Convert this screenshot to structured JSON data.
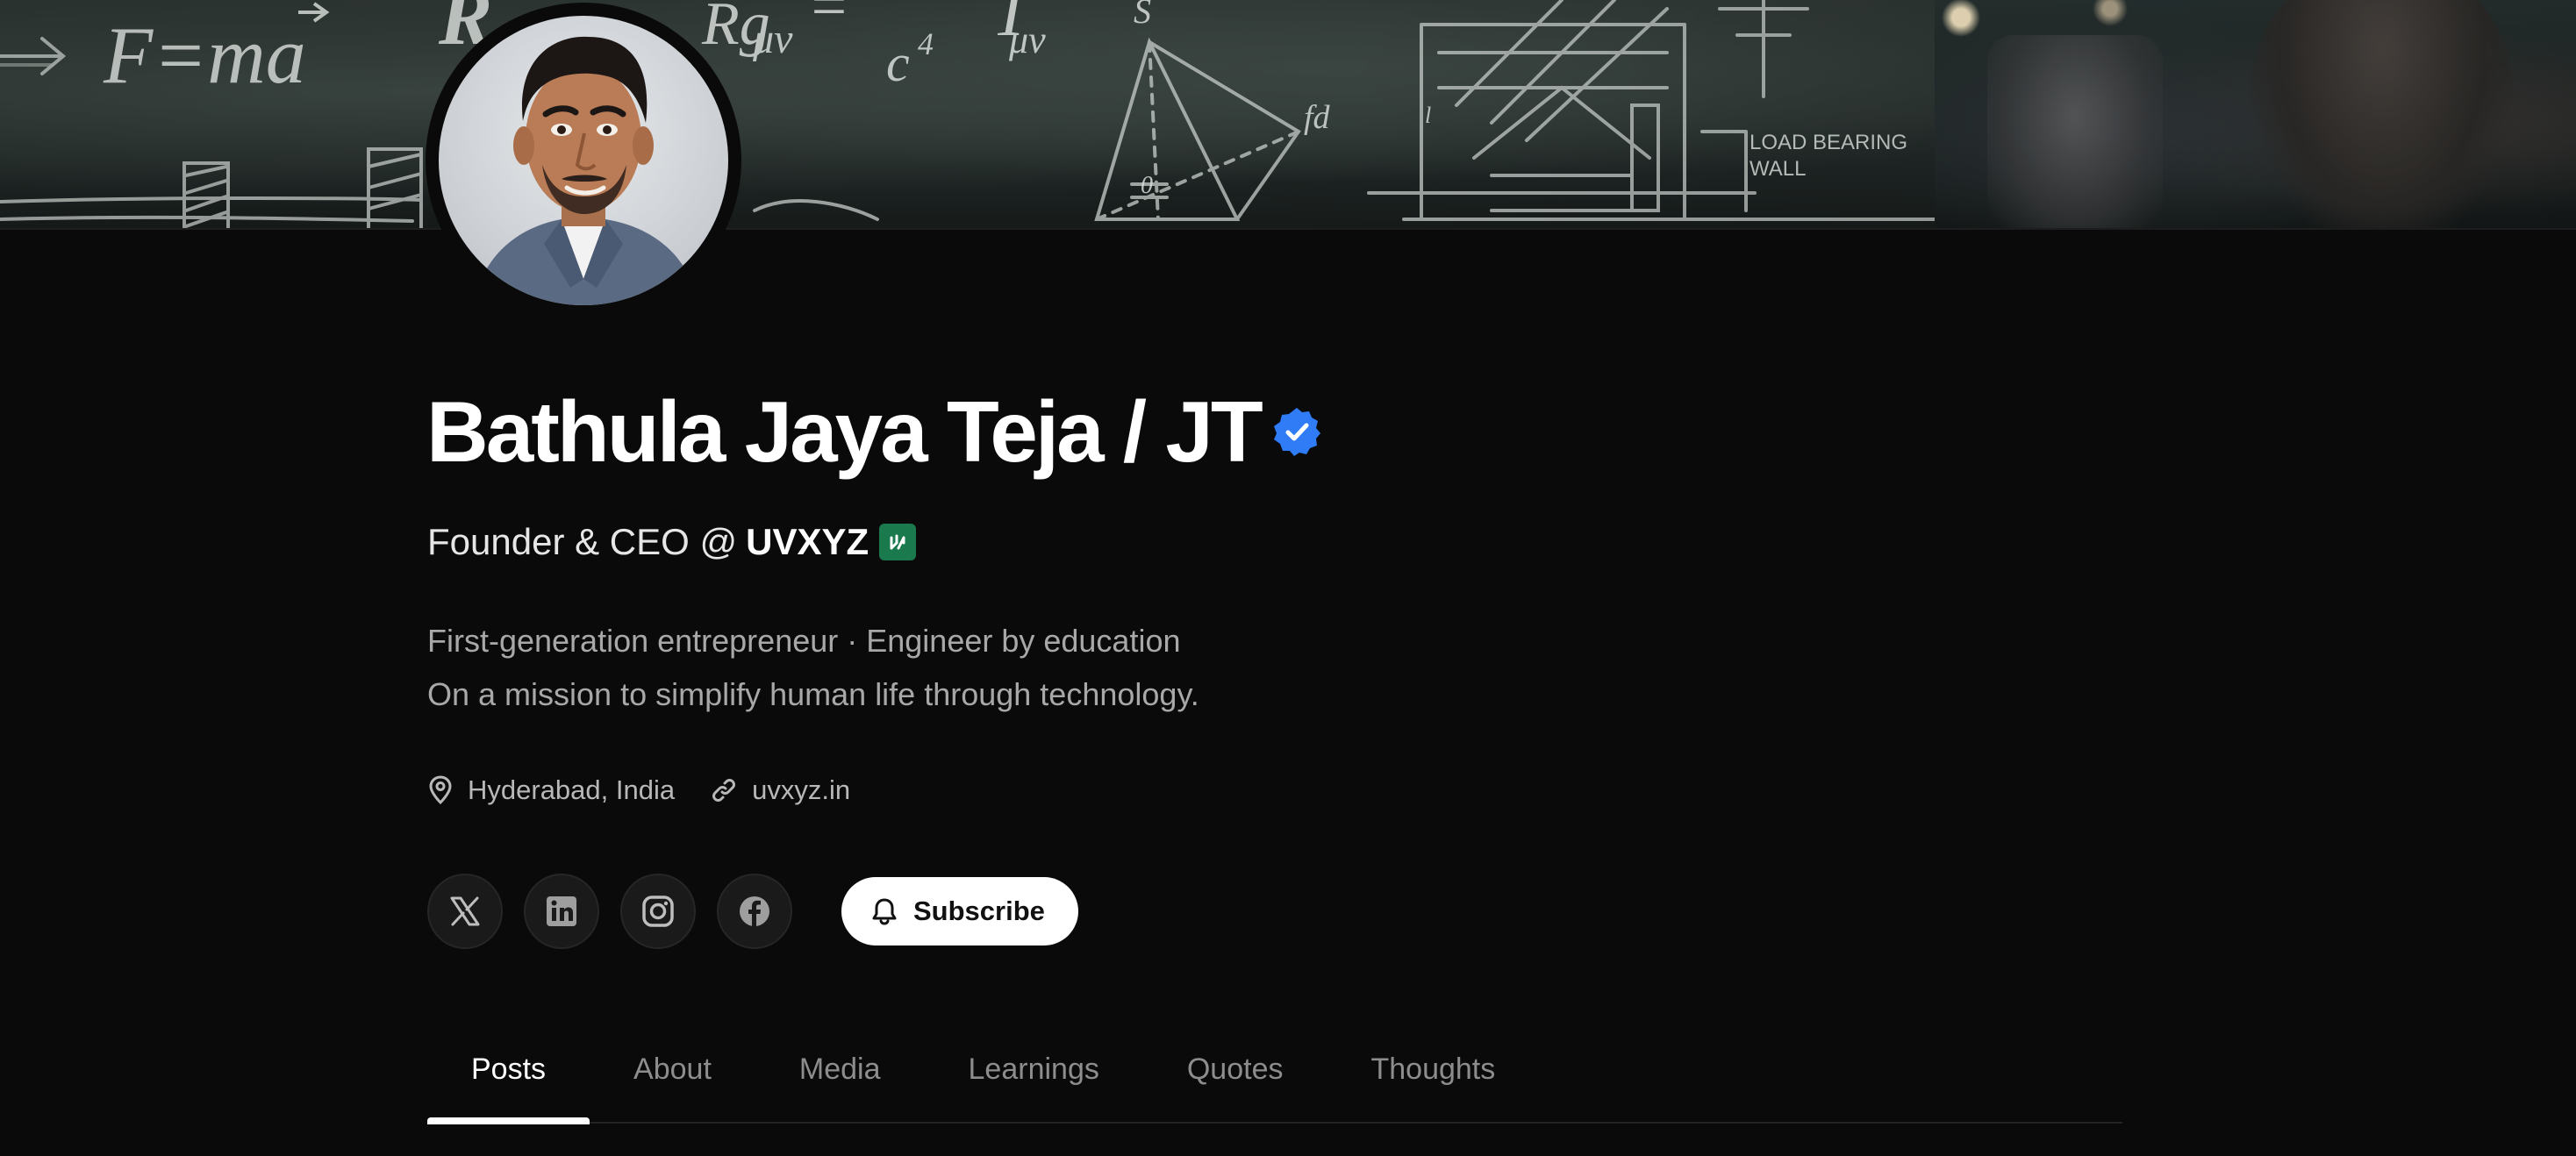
{
  "profile": {
    "name": "Bathula Jaya Teja / JT",
    "headline_prefix": "Founder & CEO @",
    "company": "UVXYZ",
    "bio_line1": "First-generation entrepreneur · Engineer by education",
    "bio_line2": "On a mission to simplify human life through technology.",
    "location": "Hyderabad, India",
    "website": "uvxyz.in"
  },
  "banner": {
    "chalk_formulas": [
      "F = ma",
      "g",
      "μv",
      "=",
      "c",
      "4",
      "T",
      "μv",
      "S",
      "LOAD BEARING",
      "WALL",
      "Rα",
      "l"
    ]
  },
  "socials": [
    {
      "name": "x-icon"
    },
    {
      "name": "linkedin-icon"
    },
    {
      "name": "instagram-icon"
    },
    {
      "name": "facebook-icon"
    }
  ],
  "actions": {
    "subscribe_label": "Subscribe"
  },
  "tabs": [
    {
      "label": "Posts",
      "active": true
    },
    {
      "label": "About",
      "active": false
    },
    {
      "label": "Media",
      "active": false
    },
    {
      "label": "Learnings",
      "active": false
    },
    {
      "label": "Quotes",
      "active": false
    },
    {
      "label": "Thoughts",
      "active": false
    }
  ],
  "colors": {
    "background": "#0a0a0a",
    "verified_badge": "#2f7cf6",
    "company_logo": "#1b7a4d",
    "subscribe_bg": "#ffffff",
    "tab_inactive": "#8d8d8d"
  }
}
